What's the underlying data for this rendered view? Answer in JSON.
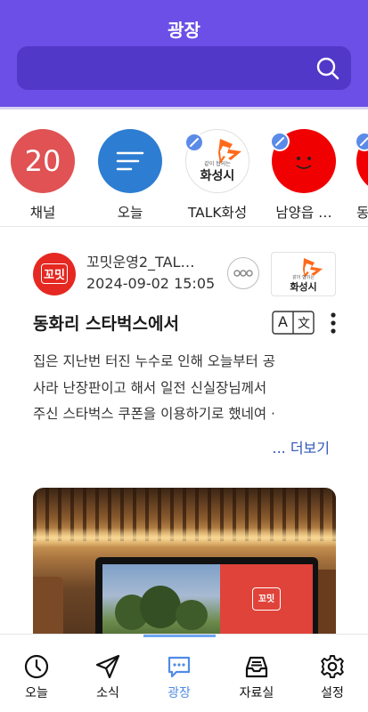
{
  "header": {
    "title": "광장",
    "search_icon": "search-icon",
    "colors": {
      "background": "#6b4fe6",
      "search_bar": "#5238c9"
    }
  },
  "channels": [
    {
      "label": "채널",
      "circle_text": "20",
      "color": "#e05253"
    },
    {
      "label": "오늘",
      "icon": "list-icon",
      "color": "#2d7dd2"
    },
    {
      "label": "TALK화성",
      "logo_text": "화성시",
      "logo_tagline": "같이 협의는",
      "edit_badge": true
    },
    {
      "label": "남양읍 …",
      "icon": "smiley-face",
      "color": "#f00000",
      "edit_badge": true
    },
    {
      "label": "동",
      "color": "#f00000",
      "edit_badge": true
    }
  ],
  "post": {
    "author": "꼬밋운영2_TAL…",
    "date": "2024-09-02 15:05",
    "avatar_text": "꼬밋",
    "channel_logo_text": "화성시",
    "channel_logo_tagline": "같이 협의는",
    "title": "동화리 스타벅스에서",
    "translate_glyphs": {
      "left": "A",
      "right": "文"
    },
    "body_lines": [
      "집은 지난번 터진 누수로 인해 오늘부터 공",
      "사라 난장판이고 해서 일전 신실장님께서",
      "주신 스타벅스 쿠폰을 이용하기로 했네여 ·"
    ],
    "more_label": "... 더보기",
    "image_logo_text": "꼬밋"
  },
  "bottom_nav": {
    "items": [
      {
        "label": "오늘",
        "icon": "clock-icon"
      },
      {
        "label": "소식",
        "icon": "send-icon"
      },
      {
        "label": "광장",
        "icon": "chat-icon",
        "active": true
      },
      {
        "label": "자료실",
        "icon": "inbox-icon"
      },
      {
        "label": "설정",
        "icon": "gear-icon"
      }
    ],
    "active_color": "#4f8be6"
  }
}
